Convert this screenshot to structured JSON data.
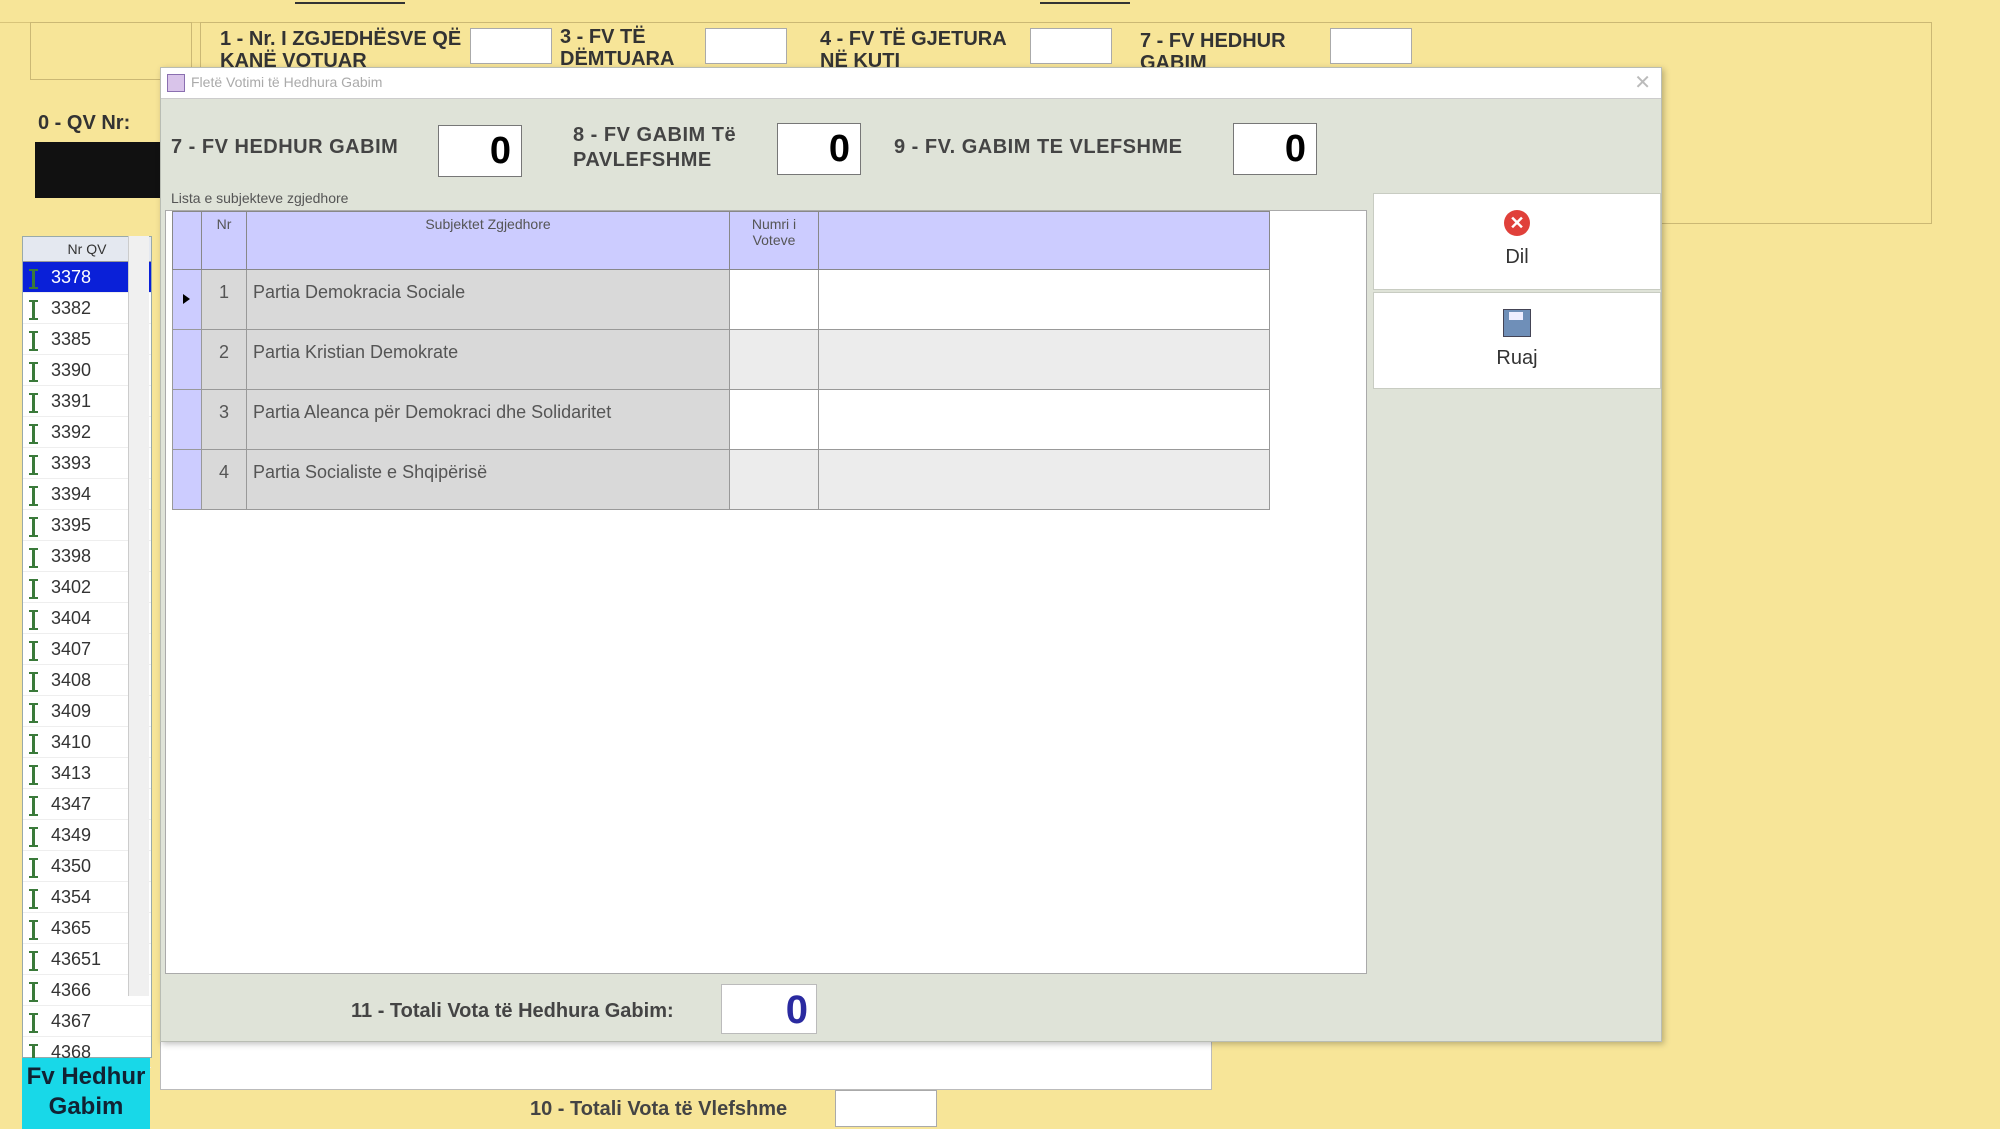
{
  "background": {
    "top_label_1": "1 - Nr. I ZGJEDHËSVE QË KANË VOTUAR",
    "top_label_3": "3 - FV TË DËMTUARA",
    "top_label_4": "4 - FV TË GJETURA NË KUTI",
    "top_label_7": "7 - FV HEDHUR GABIM",
    "qv_label": "0 - QV Nr:",
    "qv_list_header": "Nr QV",
    "qv_list": [
      "3378",
      "3382",
      "3385",
      "3390",
      "3391",
      "3392",
      "3393",
      "3394",
      "3395",
      "3398",
      "3402",
      "3404",
      "3407",
      "3408",
      "3409",
      "3410",
      "3413",
      "4347",
      "4349",
      "4350",
      "4354",
      "4365",
      "43651",
      "4366",
      "4367",
      "4368"
    ],
    "selected_qv": "3378",
    "tile_label": "Fv Hedhur Gabim",
    "bottom_label": "10 - Totali Vota të Vlefshme"
  },
  "dialog": {
    "title": "Fletë Votimi të Hedhura Gabim",
    "field7_label": "7 - FV HEDHUR GABIM",
    "field7_value": "0",
    "field8_label": "8 - FV GABIM Të PAVLEFSHME",
    "field8_value": "0",
    "field9_label": "9 - FV. GABIM TE VLEFSHME",
    "field9_value": "0",
    "grid_caption": "Lista e subjekteve zgjedhore",
    "columns": {
      "nr": "Nr",
      "subject": "Subjektet Zgjedhore",
      "votes": "Numri i Voteve"
    },
    "rows": [
      {
        "nr": "1",
        "name": "Partia Demokracia Sociale"
      },
      {
        "nr": "2",
        "name": "Partia Kristian Demokrate"
      },
      {
        "nr": "3",
        "name": "Partia Aleanca për Demokraci dhe Solidaritet"
      },
      {
        "nr": "4",
        "name": "Partia Socialiste e Shqipërisë"
      }
    ],
    "exit_label": "Dil",
    "save_label": "Ruaj",
    "total_label": "11 - Totali Vota të Hedhura Gabim:",
    "total_value": "0"
  }
}
